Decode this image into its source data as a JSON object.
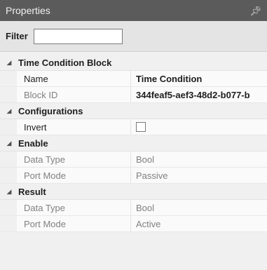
{
  "panel": {
    "title": "Properties",
    "pin_icon": "pin-icon"
  },
  "filter": {
    "label": "Filter",
    "value": "",
    "placeholder": ""
  },
  "sections": {
    "time_condition_block": {
      "title": "Time Condition Block",
      "name_label": "Name",
      "name_value": "Time Condition",
      "block_id_label": "Block ID",
      "block_id_value": "344feaf5-aef3-48d2-b077-b"
    },
    "configurations": {
      "title": "Configurations",
      "invert_label": "Invert",
      "invert_checked": false
    },
    "enable": {
      "title": "Enable",
      "data_type_label": "Data Type",
      "data_type_value": "Bool",
      "port_mode_label": "Port Mode",
      "port_mode_value": "Passive"
    },
    "result": {
      "title": "Result",
      "data_type_label": "Data Type",
      "data_type_value": "Bool",
      "port_mode_label": "Port Mode",
      "port_mode_value": "Active"
    }
  },
  "colors": {
    "titlebar": "#5b5b5b",
    "filterbar": "#e4e4e4",
    "background": "#f0f0f0"
  }
}
